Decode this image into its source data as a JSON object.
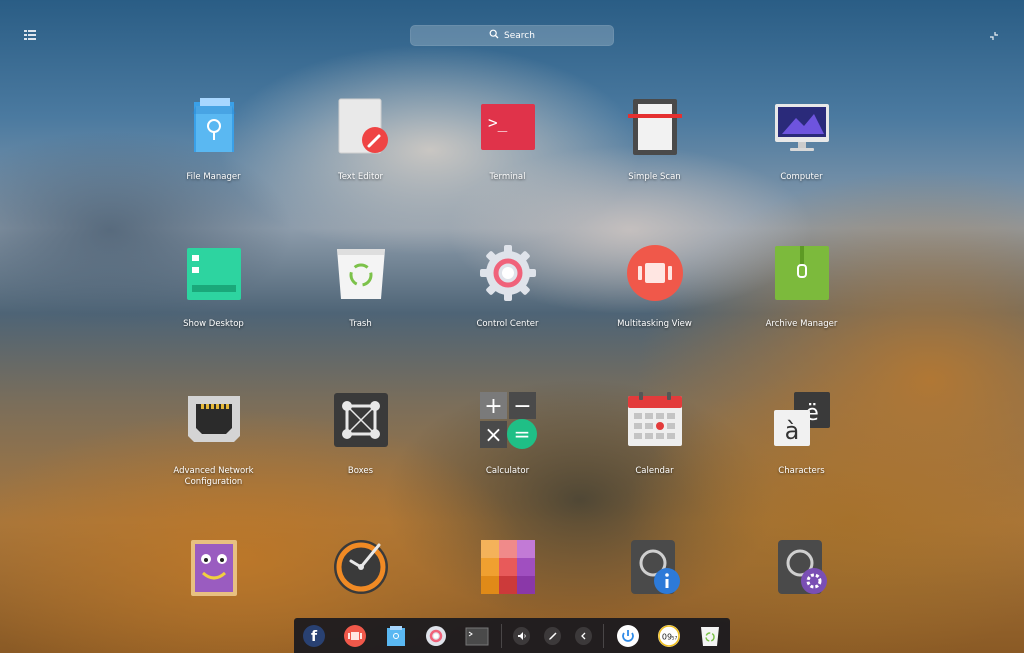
{
  "search": {
    "label": "Search"
  },
  "apps": [
    {
      "label": "File Manager",
      "icon": "file-manager-icon"
    },
    {
      "label": "Text Editor",
      "icon": "text-editor-icon"
    },
    {
      "label": "Terminal",
      "icon": "terminal-icon"
    },
    {
      "label": "Simple Scan",
      "icon": "scanner-icon"
    },
    {
      "label": "Computer",
      "icon": "computer-icon"
    },
    {
      "label": "Show Desktop",
      "icon": "show-desktop-icon"
    },
    {
      "label": "Trash",
      "icon": "trash-icon"
    },
    {
      "label": "Control Center",
      "icon": "gear-icon"
    },
    {
      "label": "Multitasking View",
      "icon": "multitasking-icon"
    },
    {
      "label": "Archive Manager",
      "icon": "archive-icon"
    },
    {
      "label": "Advanced Network Configuration",
      "icon": "network-port-icon"
    },
    {
      "label": "Boxes",
      "icon": "boxes-icon"
    },
    {
      "label": "Calculator",
      "icon": "calculator-icon"
    },
    {
      "label": "Calendar",
      "icon": "calendar-icon"
    },
    {
      "label": "Characters",
      "icon": "characters-icon"
    },
    {
      "label": "",
      "icon": "cheese-face-icon"
    },
    {
      "label": "",
      "icon": "clock-icon"
    },
    {
      "label": "",
      "icon": "color-palette-icon"
    },
    {
      "label": "",
      "icon": "disk-info-icon"
    },
    {
      "label": "",
      "icon": "disk-settings-icon"
    }
  ],
  "calculator_glyphs": {
    "plus": "+",
    "minus": "−",
    "times": "×",
    "equals": "="
  },
  "terminal_glyph": ">_",
  "characters_glyphs": {
    "front": "à",
    "back": "ë"
  },
  "dock": {
    "items": [
      "fedora-logo-icon",
      "multitasking-icon",
      "file-manager-icon",
      "gear-icon",
      "terminal-icon"
    ],
    "tray": [
      "volume-icon",
      "edit-pen-icon",
      "chevron-left-icon"
    ],
    "right": [
      "power-icon",
      "clock-icon",
      "trash-icon"
    ],
    "clock_text": "09",
    "clock_small": "57"
  }
}
